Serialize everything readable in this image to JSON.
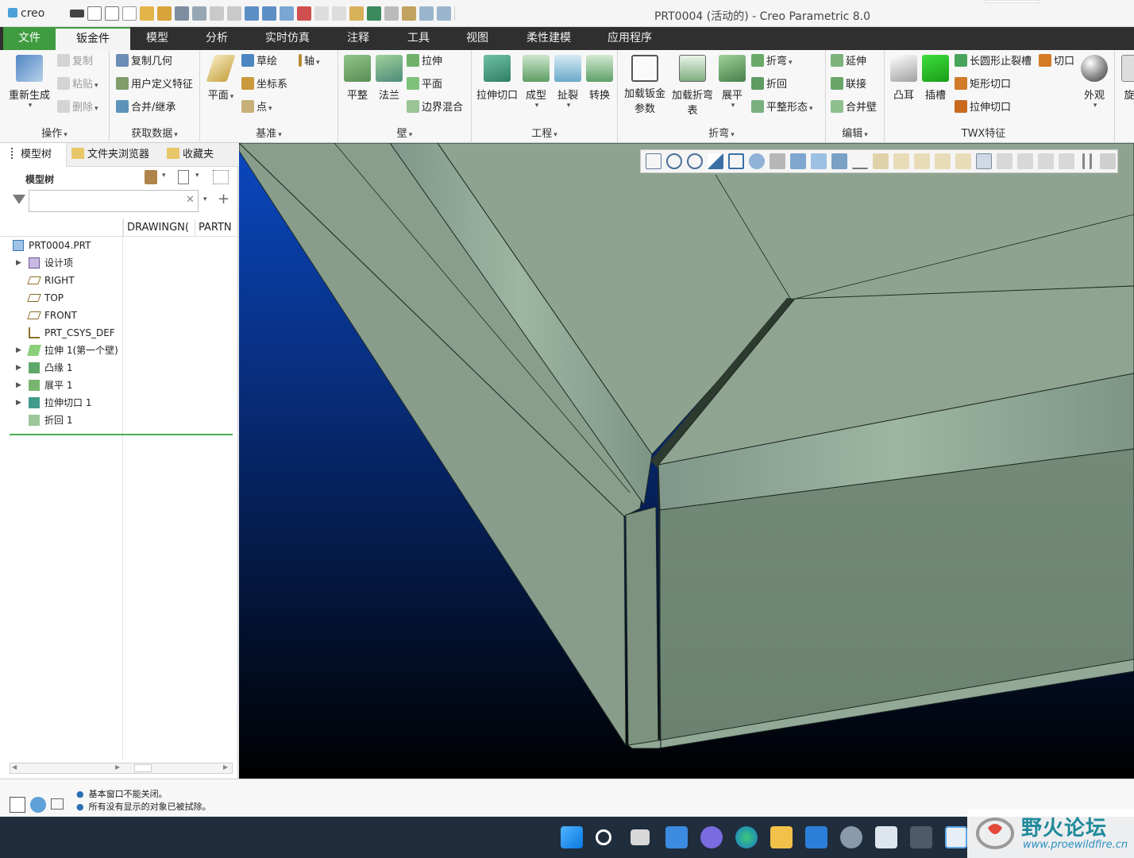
{
  "app": {
    "logo_text": "creo",
    "window_title": "PRT0004 (活动的) - Creo Parametric 8.0"
  },
  "tabs": [
    {
      "label": "文件"
    },
    {
      "label": "钣金件"
    },
    {
      "label": "模型"
    },
    {
      "label": "分析"
    },
    {
      "label": "实时仿真"
    },
    {
      "label": "注释"
    },
    {
      "label": "工具"
    },
    {
      "label": "视图"
    },
    {
      "label": "柔性建模"
    },
    {
      "label": "应用程序"
    }
  ],
  "ribbon": {
    "ops": {
      "label": "操作",
      "regen": "重新生成",
      "copy": "复制",
      "paste": "粘贴",
      "delete": "删除"
    },
    "getdata": {
      "label": "获取数据",
      "copygeom": "复制几何",
      "udf": "用户定义特征",
      "merge": "合并/继承"
    },
    "datum": {
      "label": "基准",
      "plane": "平面",
      "sketch": "草绘",
      "axis": "轴",
      "csys": "坐标系",
      "point": "点"
    },
    "wall": {
      "label": "壁",
      "flat": "平整",
      "flange": "法兰",
      "extrude": "拉伸",
      "planar": "平面",
      "blend": "边界混合"
    },
    "eng": {
      "label": "工程",
      "cut": "拉伸切口",
      "form": "成型",
      "rip": "扯裂",
      "convert": "转换"
    },
    "bend": {
      "label": "折弯",
      "loadparam": "加载钣金参数",
      "loadtable_a": "加载折弯",
      "loadtable_b": "表",
      "unbend": "展平",
      "bend": "折弯",
      "bendback": "折回",
      "flatstate": "平整形态"
    },
    "edit": {
      "label": "编辑",
      "extend": "延伸",
      "join": "联接",
      "mergewall": "合并壁"
    },
    "twx": {
      "label": "TWX特征",
      "lug": "凸耳",
      "slot": "插槽",
      "oblong": "长圆形止裂槽",
      "rectcut": "矩形切口",
      "extcut": "拉伸切口",
      "cut": "切口"
    },
    "appearance": {
      "label": "外观"
    },
    "extra": {
      "label": "旋"
    }
  },
  "navigator": {
    "tabs": {
      "model_tree": "模型树",
      "folder": "文件夹浏览器",
      "favorites": "收藏夹"
    },
    "header": "模型树",
    "filter_value": "",
    "columns": [
      "DRAWINGN(",
      "PARTN"
    ],
    "tree": [
      {
        "label": "PRT0004.PRT",
        "icon": "part-icon",
        "expand": false,
        "indent": 0
      },
      {
        "label": "设计项",
        "icon": "design-items-icon",
        "expand": true,
        "indent": 1
      },
      {
        "label": "RIGHT",
        "icon": "datum-plane-icon",
        "expand": false,
        "indent": 1
      },
      {
        "label": "TOP",
        "icon": "datum-plane-icon",
        "expand": false,
        "indent": 1
      },
      {
        "label": "FRONT",
        "icon": "datum-plane-icon",
        "expand": false,
        "indent": 1
      },
      {
        "label": "PRT_CSYS_DEF",
        "icon": "csys-icon",
        "expand": false,
        "indent": 1
      },
      {
        "label": "拉伸 1(第一个壁)",
        "icon": "extrude-wall-icon",
        "expand": true,
        "indent": 1
      },
      {
        "label": "凸缘 1",
        "icon": "flange-icon",
        "expand": true,
        "indent": 1
      },
      {
        "label": "展平 1",
        "icon": "unbend-icon",
        "expand": true,
        "indent": 1
      },
      {
        "label": "拉伸切口 1",
        "icon": "extrude-cut-icon",
        "expand": true,
        "indent": 1
      },
      {
        "label": "折回 1",
        "icon": "bendback-icon",
        "expand": false,
        "indent": 1
      }
    ]
  },
  "messages": [
    "基本窗口不能关闭。",
    "所有没有显示的对象已被拭除。"
  ],
  "watermark": {
    "title": "野火论坛",
    "url": "www.proewildfire.cn"
  },
  "colors": {
    "accent_green": "#3f9b3f",
    "tab_bar": "#2f2f2f",
    "model_face": "#8a9f8c",
    "background_top": "#0a3fa8",
    "background_bottom": "#000000"
  }
}
